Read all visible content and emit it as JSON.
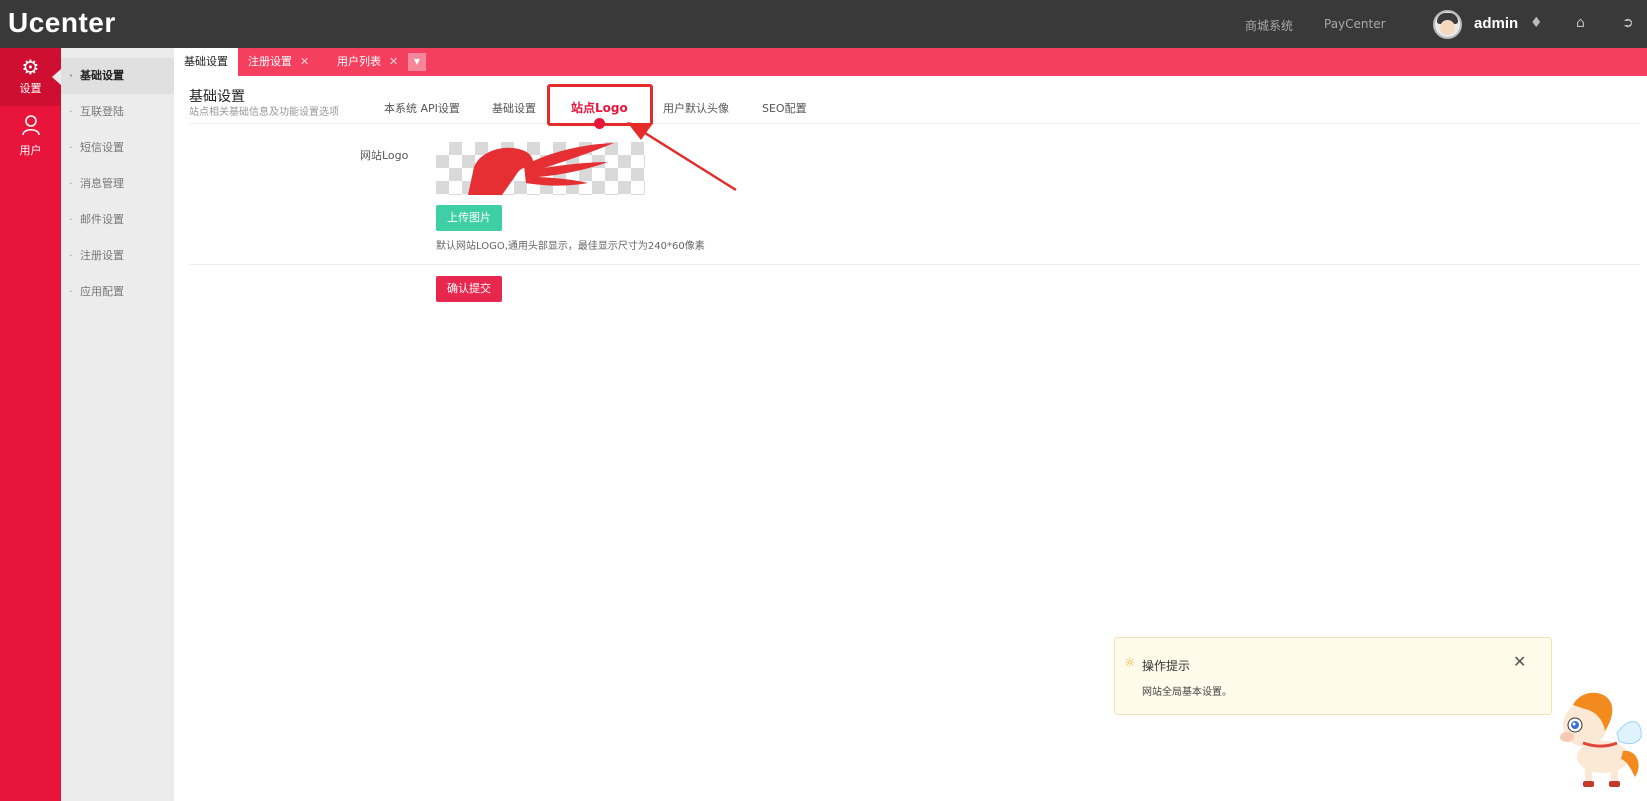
{
  "app": {
    "brand": "Ucenter"
  },
  "topnav": {
    "links": [
      "商城系统",
      "PayCenter"
    ],
    "user": "admin"
  },
  "rail": {
    "items": [
      {
        "label": "设置",
        "icon": "gear-icon"
      },
      {
        "label": "用户",
        "icon": "user-icon"
      }
    ]
  },
  "submenu": {
    "items": [
      "基础设置",
      "互联登陆",
      "短信设置",
      "消息管理",
      "邮件设置",
      "注册设置",
      "应用配置"
    ]
  },
  "tabs": [
    {
      "label": "基础设置",
      "closable": false
    },
    {
      "label": "注册设置",
      "closable": true
    },
    {
      "label": "用户列表",
      "closable": true
    }
  ],
  "page": {
    "title": "基础设置",
    "subtitle": "站点相关基础信息及功能设置选项",
    "subtabs": [
      "本系统 API设置",
      "基础设置",
      "站点Logo",
      "用户默认头像",
      "SEO配置"
    ],
    "active_subtab": "站点Logo"
  },
  "form": {
    "logo_label": "网站Logo",
    "upload_button": "上传图片",
    "help_text": "默认网站LOGO,通用头部显示，最佳显示尺寸为240*60像素",
    "submit_button": "确认提交"
  },
  "toast": {
    "title": "操作提示",
    "body": "网站全局基本设置。"
  },
  "colors": {
    "topbar": "#393939",
    "accent": "#e8143a",
    "tabbar": "#f43f5e",
    "upload": "#3fcfa4"
  }
}
